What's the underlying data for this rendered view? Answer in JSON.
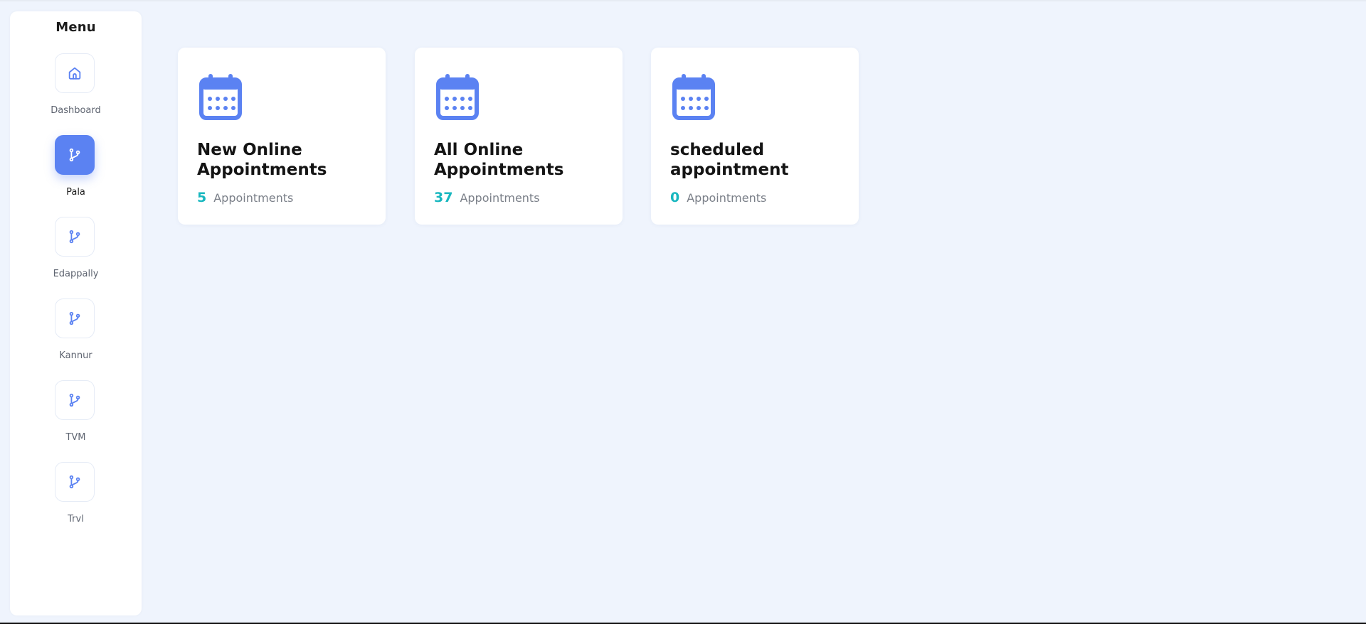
{
  "sidebar": {
    "title": "Menu",
    "items": [
      {
        "label": "Dashboard",
        "icon": "home-icon",
        "active": false
      },
      {
        "label": "Pala",
        "icon": "branch-icon",
        "active": true
      },
      {
        "label": "Edappally",
        "icon": "branch-icon",
        "active": false
      },
      {
        "label": "Kannur",
        "icon": "branch-icon",
        "active": false
      },
      {
        "label": "TVM",
        "icon": "branch-icon",
        "active": false
      },
      {
        "label": "Trvl",
        "icon": "branch-icon",
        "active": false
      }
    ]
  },
  "cards": [
    {
      "title": "New Online Appointments",
      "count": "5",
      "unit": "Appointments",
      "icon": "calendar-icon"
    },
    {
      "title": "All Online Appointments",
      "count": "37",
      "unit": "Appointments",
      "icon": "calendar-icon"
    },
    {
      "title": "scheduled appointment",
      "count": "0",
      "unit": "Appointments",
      "icon": "calendar-icon"
    }
  ],
  "colors": {
    "accent": "#5b82f2",
    "count": "#18b7bf",
    "background": "#eff4fd"
  }
}
